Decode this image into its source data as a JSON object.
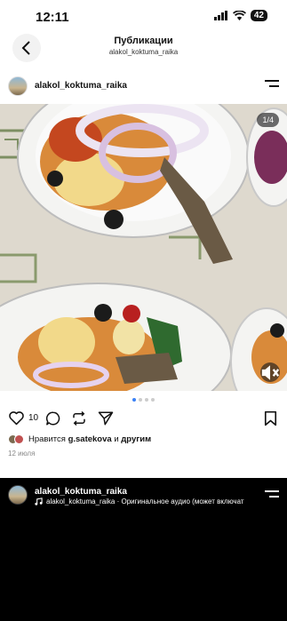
{
  "status": {
    "time": "12:11",
    "battery": "42"
  },
  "header": {
    "title": "Публикации",
    "subtitle": "alakol_koktuma_raika"
  },
  "post": {
    "username": "alakol_koktuma_raika",
    "counter": "1/4",
    "like_count": "10",
    "likes_prefix": "Нравится ",
    "likes_user": "g.satekova",
    "likes_mid": " и ",
    "likes_suffix": "другим",
    "date": "12 июля",
    "carousel": {
      "total": 4,
      "active": 1
    }
  },
  "next_post": {
    "username": "alakol_koktuma_raika",
    "audio": "alakol_koktuma_raika · Оригинальное аудио  (может включат"
  },
  "colors": {
    "accent": "#3b82f6",
    "dark": "#111111"
  }
}
